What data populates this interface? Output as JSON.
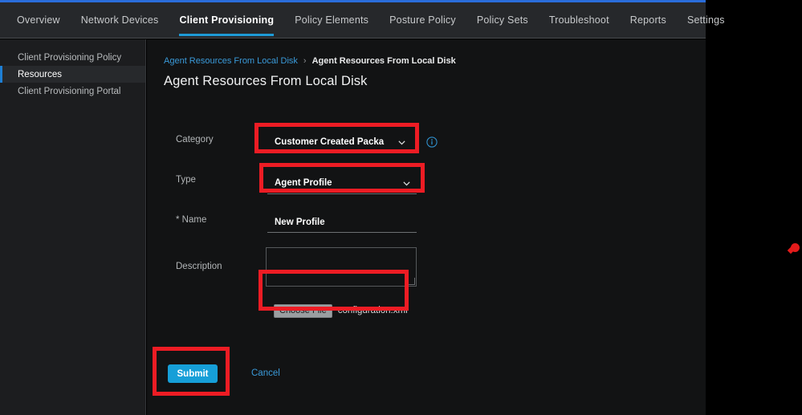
{
  "topnav": {
    "items": [
      {
        "label": "Overview",
        "active": false
      },
      {
        "label": "Network Devices",
        "active": false
      },
      {
        "label": "Client Provisioning",
        "active": true
      },
      {
        "label": "Policy Elements",
        "active": false
      },
      {
        "label": "Posture Policy",
        "active": false
      },
      {
        "label": "Policy Sets",
        "active": false
      },
      {
        "label": "Troubleshoot",
        "active": false
      },
      {
        "label": "Reports",
        "active": false
      },
      {
        "label": "Settings",
        "active": false
      }
    ],
    "accent_color": "#2a6ddb",
    "active_underline_color": "#1e9bd7"
  },
  "sidebar": {
    "items": [
      {
        "label": "Client Provisioning Policy",
        "active": false
      },
      {
        "label": "Resources",
        "active": true
      },
      {
        "label": "Client Provisioning Portal",
        "active": false
      }
    ],
    "active_indicator_color": "#1e7fd4"
  },
  "breadcrumb": {
    "parent": "Agent Resources From Local Disk",
    "separator": "›",
    "current": "Agent Resources From Local Disk"
  },
  "page": {
    "title": "Agent Resources From Local Disk"
  },
  "form": {
    "category": {
      "label": "Category",
      "value": "Customer Created Packa",
      "chevron_icon": "chevron-down-icon",
      "info_icon": "info-circle-icon"
    },
    "type": {
      "label": "Type",
      "value": "Agent Profile",
      "chevron_icon": "chevron-down-icon"
    },
    "name": {
      "label": "* Name",
      "value": "New Profile"
    },
    "description": {
      "label": "Description",
      "value": "",
      "placeholder": ""
    },
    "file": {
      "choose_label": "Choose File",
      "file_name": "configuration.xml"
    }
  },
  "actions": {
    "submit_label": "Submit",
    "submit_color": "#169fd8",
    "cancel_label": "Cancel",
    "cancel_color": "#3a9ad9"
  },
  "annotations": {
    "highlight_color": "#ed1c24",
    "cursor_color": "#e31b1b"
  }
}
